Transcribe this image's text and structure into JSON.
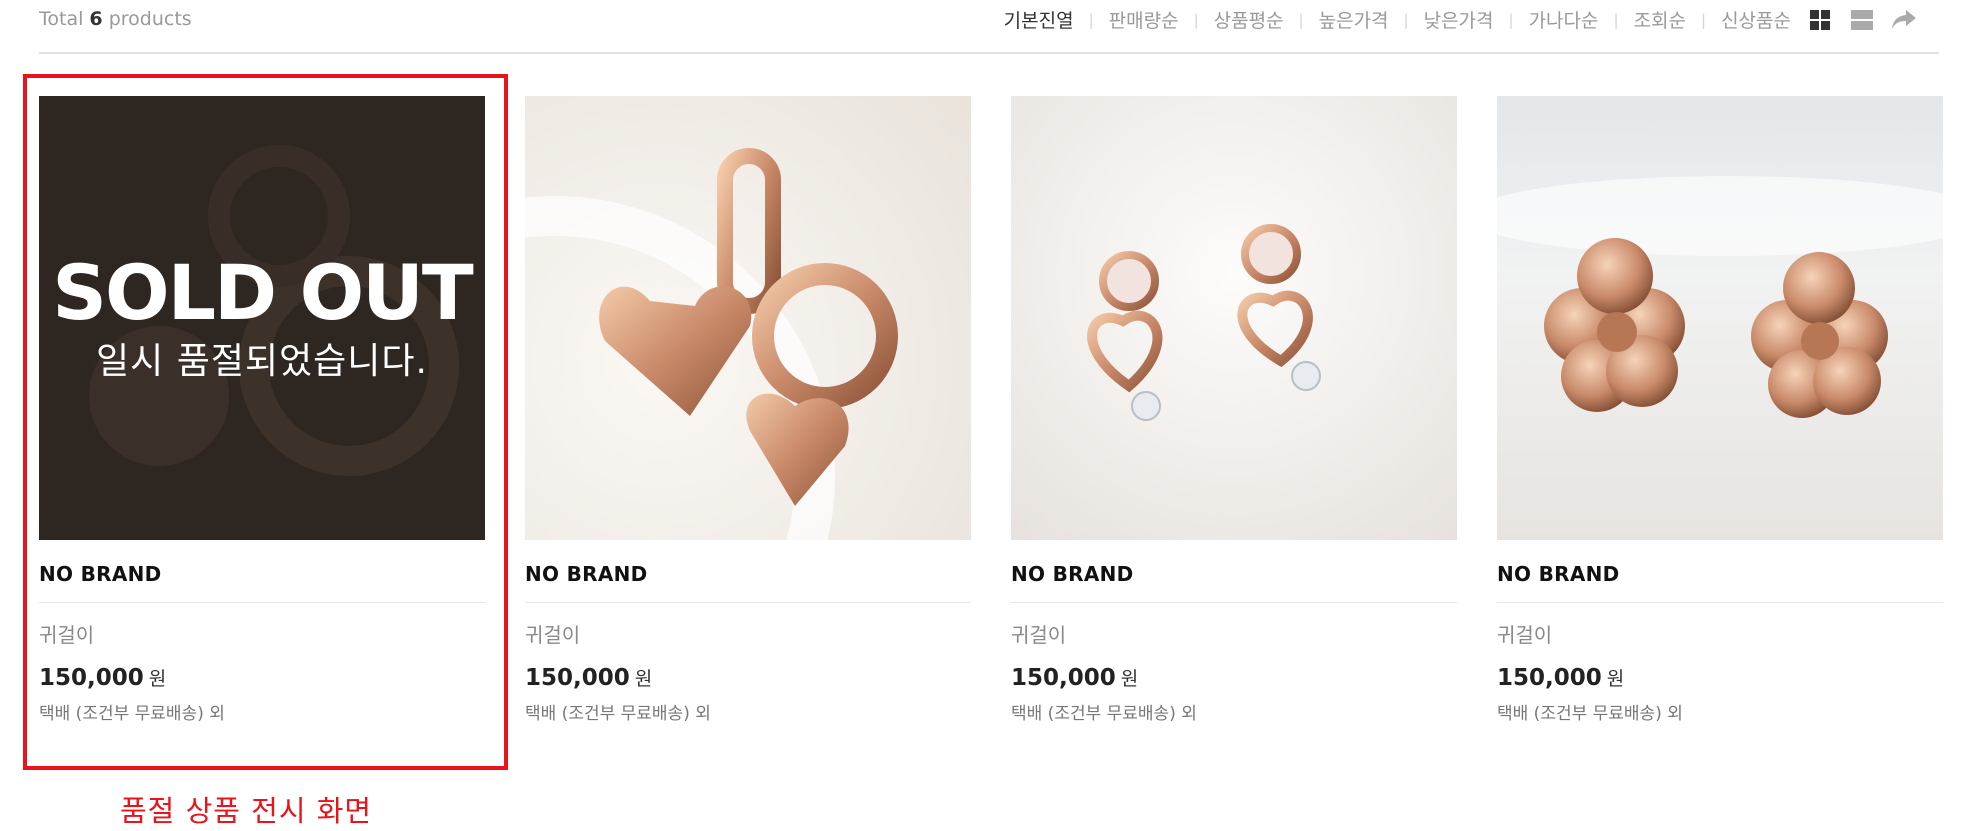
{
  "header": {
    "total_prefix": "Total",
    "total_count": "6",
    "total_suffix": "products",
    "sort_options": [
      {
        "label": "기본진열",
        "active": true
      },
      {
        "label": "판매량순",
        "active": false
      },
      {
        "label": "상품평순",
        "active": false
      },
      {
        "label": "높은가격",
        "active": false
      },
      {
        "label": "낮은가격",
        "active": false
      },
      {
        "label": "가나다순",
        "active": false
      },
      {
        "label": "조회순",
        "active": false
      },
      {
        "label": "신상품순",
        "active": false
      }
    ],
    "view_icons": [
      "grid-view-icon",
      "list-view-icon",
      "share-icon"
    ]
  },
  "products": [
    {
      "brand": "NO BRAND",
      "name": "귀걸이",
      "price": "150,000",
      "unit": "원",
      "shipping": "택배 (조건부 무료배송) 외",
      "sold_out": true,
      "overlay_title": "SOLD OUT",
      "overlay_subtitle": "일시 품절되었습니다."
    },
    {
      "brand": "NO BRAND",
      "name": "귀걸이",
      "price": "150,000",
      "unit": "원",
      "shipping": "택배 (조건부 무료배송) 외",
      "sold_out": false
    },
    {
      "brand": "NO BRAND",
      "name": "귀걸이",
      "price": "150,000",
      "unit": "원",
      "shipping": "택배 (조건부 무료배송) 외",
      "sold_out": false
    },
    {
      "brand": "NO BRAND",
      "name": "귀걸이",
      "price": "150,000",
      "unit": "원",
      "shipping": "택배 (조건부 무료배송) 외",
      "sold_out": false
    }
  ],
  "annotation": {
    "caption": "품절 상품 전시 화면",
    "color": "#e8131b"
  },
  "colors": {
    "rose_gold": "#c98a6a",
    "rose_gold_light": "#f0c3a5",
    "rose_gold_dark": "#8e5438"
  }
}
